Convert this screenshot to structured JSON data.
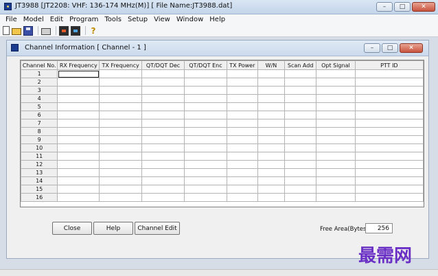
{
  "app": {
    "title": "JT3988 [JT2208: VHF: 136-174 MHz(M)] [ File Name:JT3988.dat]",
    "window_buttons": {
      "minimize": "–",
      "maximize": "□",
      "close": "✕"
    }
  },
  "menu": [
    "File",
    "Model",
    "Edit",
    "Program",
    "Tools",
    "Setup",
    "View",
    "Window",
    "Help"
  ],
  "toolbar": {
    "icons": [
      "new-file-icon",
      "open-folder-icon",
      "save-icon",
      "print-icon",
      "read-radio-icon",
      "write-radio-icon",
      "help-icon"
    ],
    "help_glyph": "?"
  },
  "child_window": {
    "title": "Channel Information [ Channel - 1 ]",
    "window_buttons": {
      "minimize": "–",
      "maximize": "□",
      "close": "✕"
    }
  },
  "table": {
    "columns": [
      "Channel No.",
      "RX Frequency",
      "TX Frequency",
      "QT/DQT Dec",
      "QT/DQT Enc",
      "TX Power",
      "W/N",
      "Scan Add",
      "Opt Signal",
      "PTT ID"
    ],
    "rows": [
      "1",
      "2",
      "3",
      "4",
      "5",
      "6",
      "7",
      "8",
      "9",
      "10",
      "11",
      "12",
      "13",
      "14",
      "15",
      "16"
    ]
  },
  "buttons": {
    "close": "Close",
    "help": "Help",
    "channel_edit": "Channel Edit"
  },
  "free_area": {
    "label": "Free Area(Bytes):",
    "value": "256"
  },
  "watermark": "最需网",
  "colors": {
    "titlebar": "#c3d5ea",
    "close_button": "#c8543e",
    "watermark": "#6a2fc4"
  }
}
